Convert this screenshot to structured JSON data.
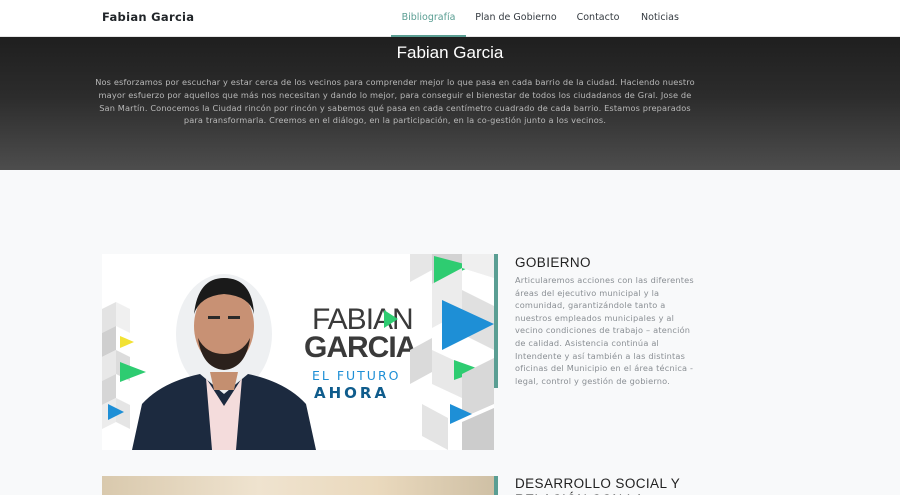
{
  "navbar": {
    "brand": "Fabian Garcia",
    "links": [
      {
        "label": "Bibliografía",
        "active": true
      },
      {
        "label": "Plan de Gobierno",
        "active": false
      },
      {
        "label": "Contacto",
        "active": false
      },
      {
        "label": "Noticias",
        "active": false
      }
    ]
  },
  "hero": {
    "title": "Fabian Garcia",
    "text": "Nos esforzamos por escuchar y estar cerca de los vecinos para comprender mejor lo que pasa en cada barrio de la ciudad. Haciendo nuestro mayor esfuerzo por aquellos que más nos necesitan y dando lo mejor, para conseguir el bienestar de todos los ciudadanos de Gral. Jose de San Martín. Conocemos la Ciudad rincón por rincón y sabemos qué pasa en cada centímetro cuadrado de cada barrio. Estamos preparados para transformarla. Creemos en el diálogo, en la participación, en la co-gestión junto a los vecinos."
  },
  "sections": [
    {
      "title": "GOBIERNO",
      "text": "Articularemos acciones con las diferentes áreas del ejecutivo municipal y la comunidad, garantizándole tanto a nuestros empleados municipales y al vecino condiciones de trabajo – atención de calidad. Asistencia continúa al Intendente y así también a las distintas oficinas del Municipio en el área técnica - legal, control y gestión de gobierno."
    },
    {
      "title": "DESARROLLO SOCIAL Y RELACIÓN CON LA"
    }
  ],
  "banner": {
    "name_line1": "FABIAN",
    "name_line2": "GARCIA",
    "slogan_line1": "EL FUTURO",
    "slogan_line2": "AHORA"
  },
  "colors": {
    "accent": "#5a9e93",
    "hero_dark": "#1f1f1f",
    "banner_green": "#2ecc71",
    "banner_blue": "#1e8fd6",
    "banner_navy": "#0f5c8c",
    "banner_yellow": "#f2e234"
  }
}
